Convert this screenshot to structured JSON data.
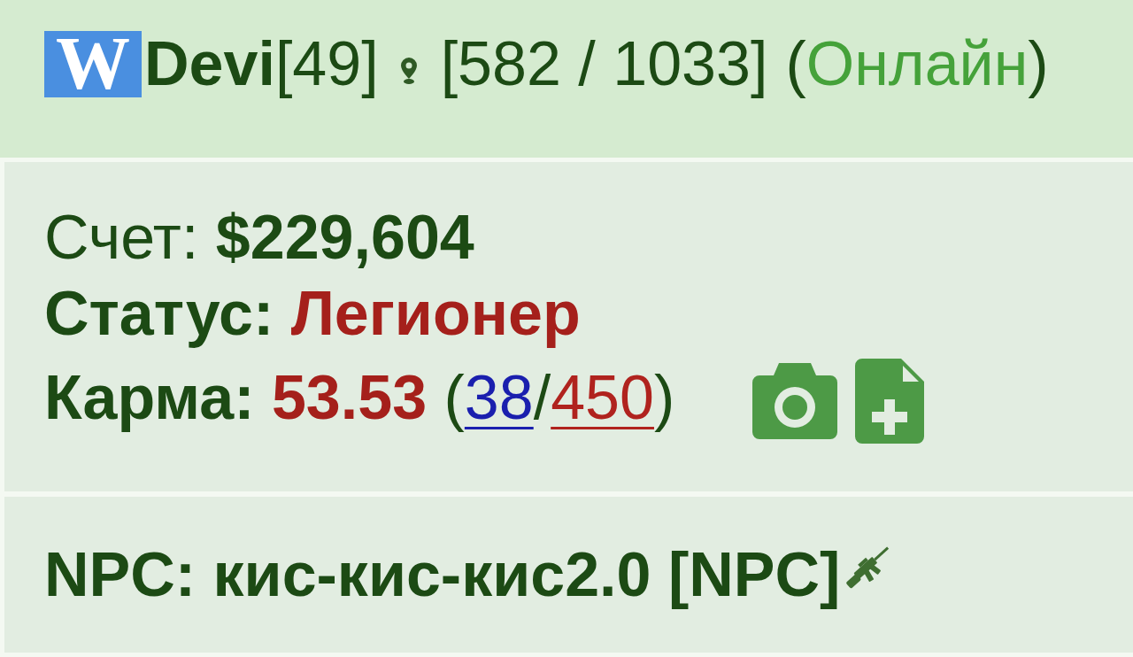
{
  "header": {
    "logo": "W",
    "player": "Devi",
    "rank": "[49]",
    "points": "[582 / 1033]",
    "presence_open": "(",
    "presence": "Онлайн",
    "presence_close": ")",
    "online": true
  },
  "info": {
    "balance": {
      "label": "Счет:",
      "value": "$229,604"
    },
    "status": {
      "label": "Статус:",
      "value": "Легионер"
    },
    "karma": {
      "label": "Карма:",
      "value": "53.53",
      "open": "(",
      "plus": "38",
      "separator": "/",
      "minus": "450",
      "close": ")"
    }
  },
  "npc": {
    "label": "NPC:",
    "name": "кис-кис-кис2.0",
    "tag": "[NPC]"
  }
}
